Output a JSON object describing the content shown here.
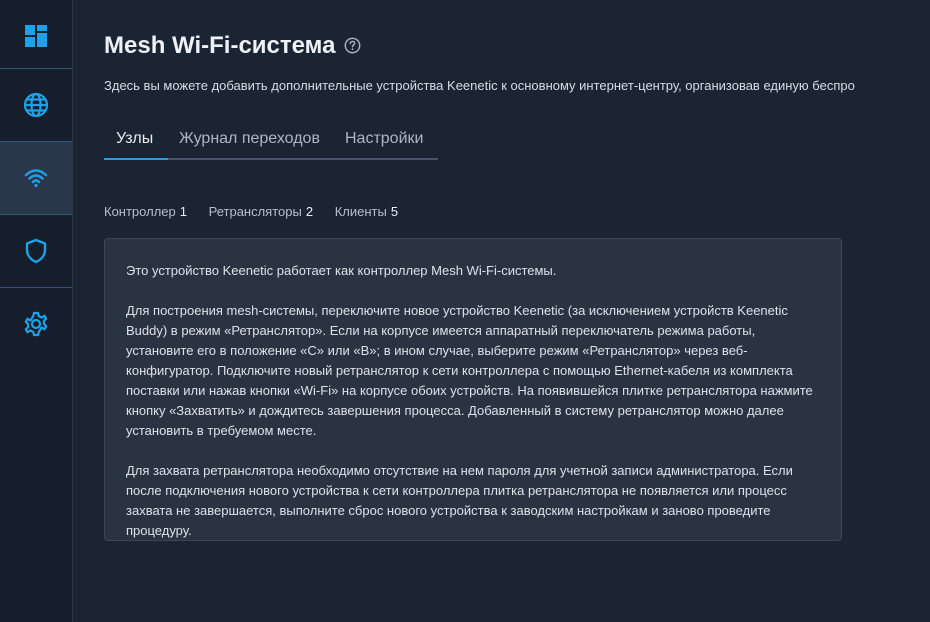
{
  "sidebar": {
    "items": [
      {
        "icon": "dashboard-icon",
        "active": false
      },
      {
        "icon": "globe-icon",
        "active": false
      },
      {
        "icon": "wifi-icon",
        "active": true
      },
      {
        "icon": "shield-icon",
        "active": false
      },
      {
        "icon": "gear-icon",
        "active": false
      }
    ],
    "accent_color": "#1da1e8"
  },
  "page": {
    "title": "Mesh Wi-Fi-система",
    "subtitle": "Здесь вы можете добавить дополнительные устройства Keenetic к основному интернет-центру, организовав единую беспро"
  },
  "tabs": [
    {
      "label": "Узлы",
      "active": true
    },
    {
      "label": "Журнал переходов",
      "active": false
    },
    {
      "label": "Настройки",
      "active": false
    }
  ],
  "counters": [
    {
      "label": "Контроллер",
      "value": "1"
    },
    {
      "label": "Ретрансляторы",
      "value": "2"
    },
    {
      "label": "Клиенты",
      "value": "5"
    }
  ],
  "info": {
    "paragraph1": "Это устройство Keenetic работает как контроллер Mesh Wi-Fi-системы.",
    "paragraph2": "Для построения mesh-системы, переключите новое устройство Keenetic (за исключением устройств Keenetic Buddy) в режим «Ретранслятор». Если на корпусе имеется аппаратный переключатель режима работы, установите его в положение «C» или «B»; в ином случае, выберите режим «Ретранслятор» через веб-конфигуратор. Подключите новый ретранслятор к сети контроллера с помощью Ethernet-кабеля из комплекта поставки или нажав кнопки «Wi-Fi» на корпусе обоих устройств. На появившейся плитке ретранслятора нажмите кнопку «Захватить» и дождитесь завершения процесса. Добавленный в систему ретранслятор можно далее установить в требуемом месте.",
    "paragraph3": "Для захвата ретранслятора необходимо отсутствие на нем пароля для учетной записи администратора. Если после подключения нового устройства к сети контроллера плитка ретранслятора не появляется или процесс захвата не завершается, выполните сброс нового устройства к заводским настройкам и заново проведите процедуру."
  }
}
